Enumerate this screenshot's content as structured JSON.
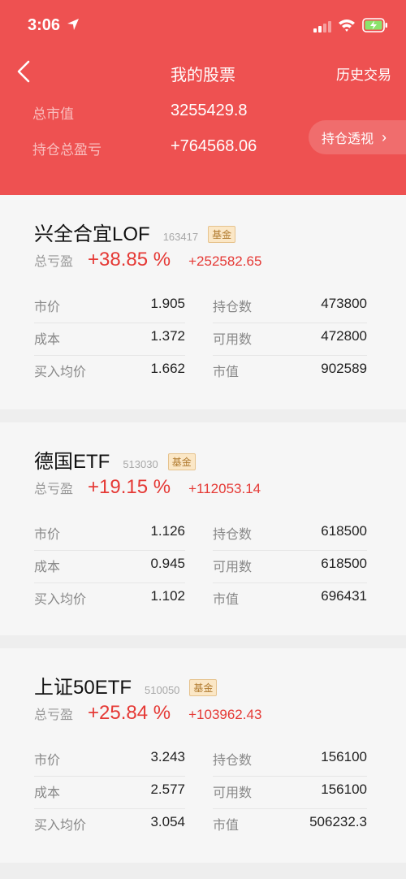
{
  "status": {
    "time": "3:06"
  },
  "nav": {
    "title": "我的股票",
    "history": "历史交易"
  },
  "summary": {
    "market_value_label": "总市值",
    "market_value": "3255429.8",
    "pl_label": "持仓总盈亏",
    "pl_value": "+764568.06",
    "position_view": "持仓透视",
    "chevron": "›"
  },
  "colors": {
    "header_red": "#ee5151",
    "gain_red": "#e53935"
  },
  "stocks": [
    {
      "name": "兴全合宜LOF",
      "code": "163417",
      "badge": "基金",
      "pl_label": "总亏盈",
      "pl_pct": "+38.85 %",
      "pl_amt": "+252582.65",
      "rows": [
        {
          "l_label": "市价",
          "l_value": "1.905",
          "r_label": "持仓数",
          "r_value": "473800"
        },
        {
          "l_label": "成本",
          "l_value": "1.372",
          "r_label": "可用数",
          "r_value": "472800"
        },
        {
          "l_label": "买入均价",
          "l_value": "1.662",
          "r_label": "市值",
          "r_value": "902589"
        }
      ]
    },
    {
      "name": "德国ETF",
      "code": "513030",
      "badge": "基金",
      "pl_label": "总亏盈",
      "pl_pct": "+19.15 %",
      "pl_amt": "+112053.14",
      "rows": [
        {
          "l_label": "市价",
          "l_value": "1.126",
          "r_label": "持仓数",
          "r_value": "618500"
        },
        {
          "l_label": "成本",
          "l_value": "0.945",
          "r_label": "可用数",
          "r_value": "618500"
        },
        {
          "l_label": "买入均价",
          "l_value": "1.102",
          "r_label": "市值",
          "r_value": "696431"
        }
      ]
    },
    {
      "name": "上证50ETF",
      "code": "510050",
      "badge": "基金",
      "pl_label": "总亏盈",
      "pl_pct": "+25.84 %",
      "pl_amt": "+103962.43",
      "rows": [
        {
          "l_label": "市价",
          "l_value": "3.243",
          "r_label": "持仓数",
          "r_value": "156100"
        },
        {
          "l_label": "成本",
          "l_value": "2.577",
          "r_label": "可用数",
          "r_value": "156100"
        },
        {
          "l_label": "买入均价",
          "l_value": "3.054",
          "r_label": "市值",
          "r_value": "506232.3"
        }
      ]
    }
  ]
}
